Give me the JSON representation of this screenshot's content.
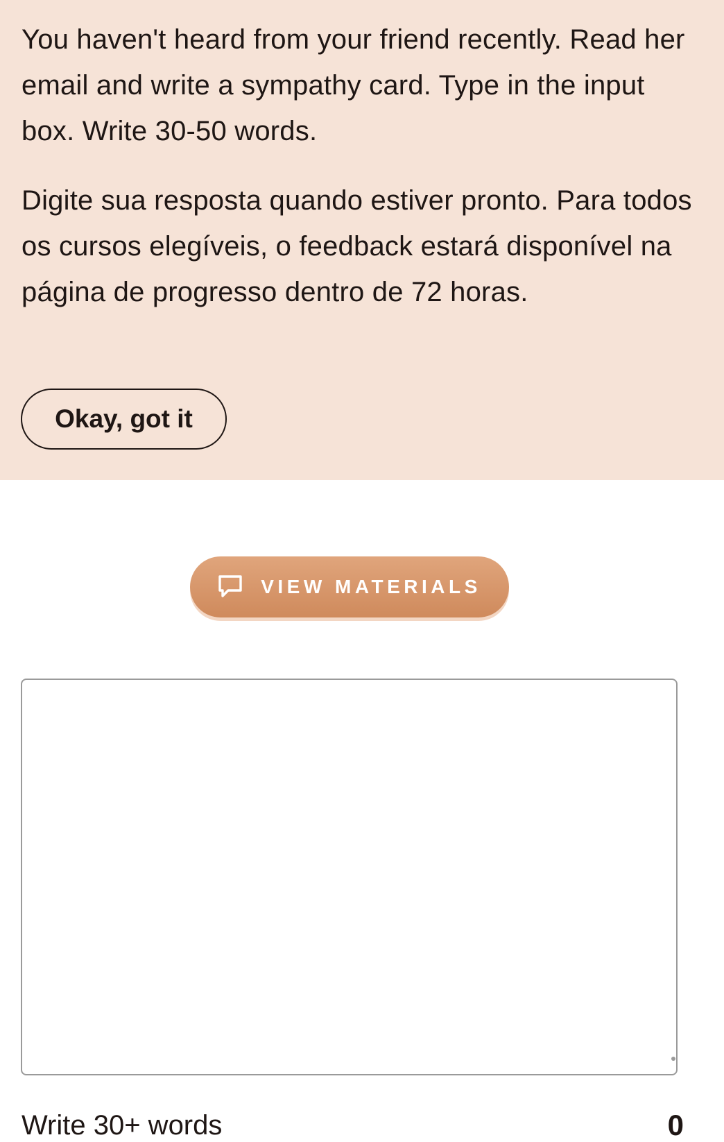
{
  "instructions": {
    "prompt_en": "You haven't heard from your friend recently. Read her email and write a sympathy card. Type in the input box. Write 30-50 words.",
    "prompt_pt": "Digite sua resposta quando estiver pronto. Para todos os cursos elegíveis, o feedback estará disponível na página de progresso dentro de 72 horas.",
    "acknowledge_label": "Okay, got it"
  },
  "materials": {
    "button_label": "VIEW MATERIALS",
    "icon": "comment-icon"
  },
  "answer": {
    "value": "",
    "placeholder": ""
  },
  "footer": {
    "word_hint": "Write 30+ words",
    "word_count": "0"
  },
  "colors": {
    "panel_background": "#f6e3d7",
    "accent": "#d99a6e",
    "text": "#1e1614",
    "input_border": "#9a9a9a"
  }
}
